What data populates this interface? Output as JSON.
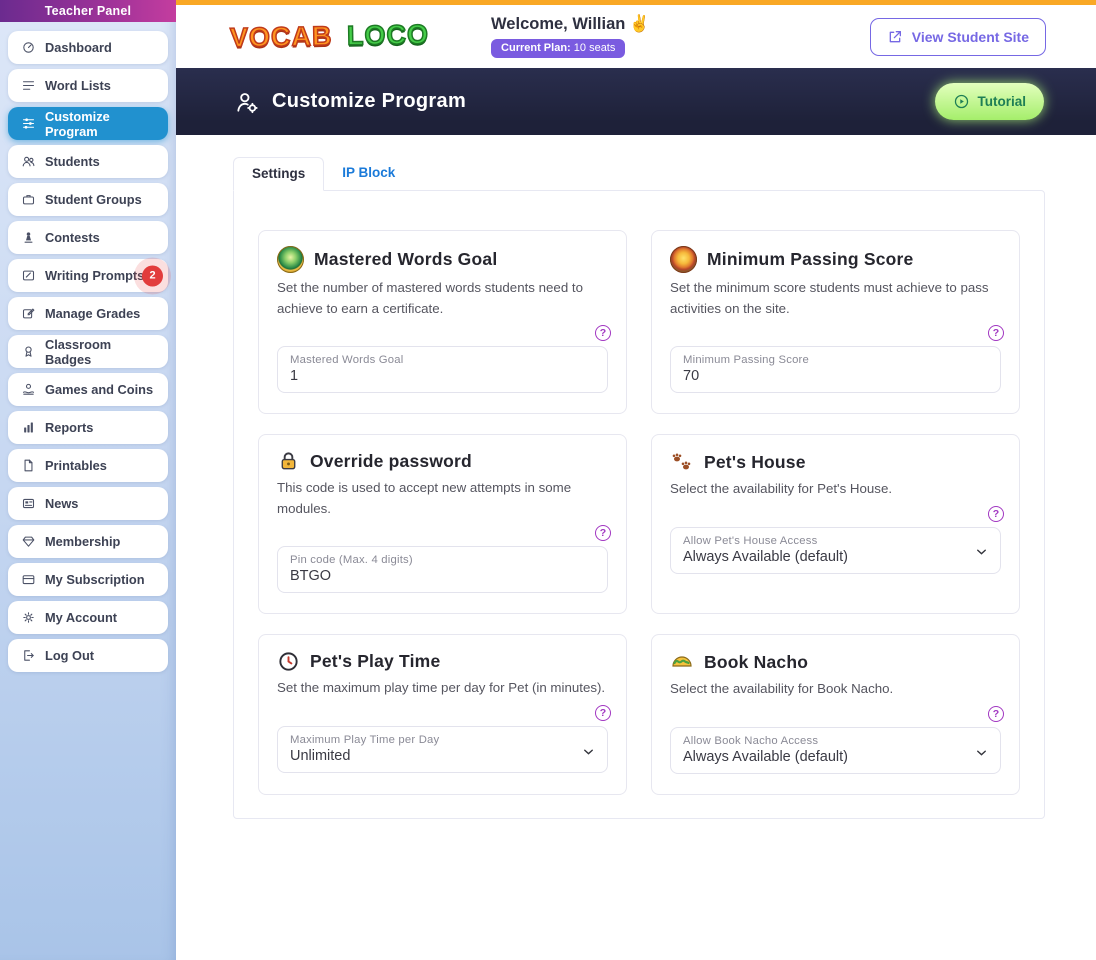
{
  "colors": {
    "accent_blue": "#2191cf",
    "navy_header": "#1e2139",
    "top_strip": "#f9a825",
    "plan_badge_purple": "#7a5be0",
    "view_site_purple": "#7668e4",
    "tutorial_green_text": "#1e7e55",
    "badge_red": "#e23c3c",
    "help_purple": "#a238c2",
    "tab_link_blue": "#1a7ad9",
    "sidebar_title_gradient": [
      "#6b2b8f",
      "#c43d9f"
    ]
  },
  "sidebar": {
    "title": "Teacher Panel",
    "items": [
      {
        "label": "Dashboard",
        "icon": "dashboard-icon",
        "active": false
      },
      {
        "label": "Word Lists",
        "icon": "list-icon",
        "active": false
      },
      {
        "label": "Customize Program",
        "icon": "sliders-icon",
        "active": true
      },
      {
        "label": "Students",
        "icon": "students-icon",
        "active": false
      },
      {
        "label": "Student Groups",
        "icon": "briefcase-icon",
        "active": false
      },
      {
        "label": "Contests",
        "icon": "trophy-icon",
        "active": false
      },
      {
        "label": "Writing Prompts",
        "icon": "note-pencil-icon",
        "active": false,
        "badge": "2"
      },
      {
        "label": "Manage Grades",
        "icon": "edit-icon",
        "active": false
      },
      {
        "label": "Classroom Badges",
        "icon": "medal-icon",
        "active": false
      },
      {
        "label": "Games and Coins",
        "icon": "coin-hand-icon",
        "active": false
      },
      {
        "label": "Reports",
        "icon": "bar-chart-icon",
        "active": false
      },
      {
        "label": "Printables",
        "icon": "document-icon",
        "active": false
      },
      {
        "label": "News",
        "icon": "newspaper-icon",
        "active": false
      },
      {
        "label": "Membership",
        "icon": "gem-icon",
        "active": false
      },
      {
        "label": "My Subscription",
        "icon": "card-icon",
        "active": false
      },
      {
        "label": "My Account",
        "icon": "gear-icon",
        "active": false
      },
      {
        "label": "Log Out",
        "icon": "logout-icon",
        "active": false
      }
    ]
  },
  "header": {
    "logo_word1": "VOCAB",
    "logo_word2": "LOCO",
    "welcome": "Welcome, Willian",
    "welcome_emoji": "✌",
    "plan_badge_label": "Current Plan:",
    "plan_badge_value": "10 seats",
    "view_student_site_label": "View Student Site"
  },
  "program_header": {
    "title": "Customize Program",
    "tutorial_label": "Tutorial"
  },
  "tabs": [
    {
      "label": "Settings",
      "active": true
    },
    {
      "label": "IP Block",
      "active": false
    }
  ],
  "cards": [
    {
      "icon": "globe-medal-icon",
      "title": "Mastered Words Goal",
      "description": "Set the number of mastered words students need to achieve to earn a certificate.",
      "field": {
        "type": "input",
        "label": "Mastered Words Goal",
        "value": "1"
      }
    },
    {
      "icon": "sun-score-icon",
      "title": "Minimum Passing Score",
      "description": "Set the minimum score students must achieve to pass activities on the site.",
      "field": {
        "type": "input",
        "label": "Minimum Passing Score",
        "value": "70"
      }
    },
    {
      "icon": "lock-icon",
      "title": "Override password",
      "description": "This code is used to accept new attempts in some modules.",
      "field": {
        "type": "input",
        "label": "Pin code (Max. 4 digits)",
        "value": "BTGO"
      }
    },
    {
      "icon": "paw-prints-icon",
      "title": "Pet's House",
      "description": "Select the availability for Pet's House.",
      "field": {
        "type": "select",
        "label": "Allow Pet's House Access",
        "value": "Always Available (default)"
      }
    },
    {
      "icon": "clock-icon",
      "title": "Pet's Play Time",
      "description": "Set the maximum play time per day for Pet (in minutes).",
      "field": {
        "type": "select",
        "label": "Maximum Play Time per Day",
        "value": "Unlimited"
      }
    },
    {
      "icon": "taco-icon",
      "title": "Book Nacho",
      "description": "Select the availability for Book Nacho.",
      "field": {
        "type": "select",
        "label": "Allow Book Nacho Access",
        "value": "Always Available (default)"
      }
    }
  ],
  "help_glyph": "?"
}
